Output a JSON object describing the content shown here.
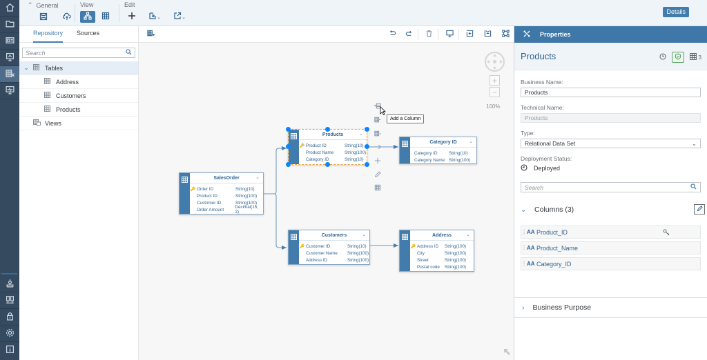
{
  "rail": {
    "items": [
      {
        "icon": "home-icon",
        "active": false
      },
      {
        "icon": "folder-icon",
        "active": false
      },
      {
        "icon": "contact-card-icon",
        "active": false
      },
      {
        "icon": "presentation-icon",
        "active": false
      },
      {
        "icon": "data-builder-icon",
        "active": true
      },
      {
        "icon": "monitor-icon",
        "active": false
      }
    ],
    "bottom_items": [
      {
        "icon": "network-icon"
      },
      {
        "icon": "connections-icon"
      },
      {
        "icon": "lock-icon"
      },
      {
        "icon": "settings-icon"
      },
      {
        "icon": "info-icon"
      }
    ]
  },
  "toolbar": {
    "general_label": "General",
    "view_label": "View",
    "edit_label": "Edit",
    "details_label": "Details"
  },
  "repository": {
    "tabs": [
      {
        "label": "Repository",
        "selected": true
      },
      {
        "label": "Sources",
        "selected": false
      }
    ],
    "search_placeholder": "Search",
    "tree": {
      "tables_label": "Tables",
      "tables": [
        "Address",
        "Customers",
        "Products"
      ],
      "views_label": "Views"
    }
  },
  "canvas": {
    "zoom_level": "100%",
    "tooltip": "Add a Column",
    "entities": {
      "salesorder": {
        "name": "SalesOrder",
        "columns": [
          {
            "name": "Order ID",
            "type": "String(10)",
            "key": true
          },
          {
            "name": "Product ID",
            "type": "String(100)",
            "key": false
          },
          {
            "name": "Customer ID",
            "type": "String(100)",
            "key": false
          },
          {
            "name": "Order Amount",
            "type": "Decimal(15, 2)",
            "key": false
          }
        ]
      },
      "products": {
        "name": "Products",
        "selected": true,
        "columns": [
          {
            "name": "Product ID",
            "type": "String(10)",
            "key": true
          },
          {
            "name": "Product Name",
            "type": "String(100)",
            "key": false
          },
          {
            "name": "Category ID",
            "type": "String(10)",
            "key": false
          }
        ]
      },
      "category": {
        "name": "Category ID",
        "columns": [
          {
            "name": "Category ID",
            "type": "String(10)",
            "key": false
          },
          {
            "name": "Category Name",
            "type": "String(100)",
            "key": false
          }
        ]
      },
      "customers": {
        "name": "Customers",
        "columns": [
          {
            "name": "Customer ID",
            "type": "String(10)",
            "key": true
          },
          {
            "name": "Customer Name",
            "type": "String(100)",
            "key": false
          },
          {
            "name": "Address ID",
            "type": "String(100)",
            "key": false
          }
        ]
      },
      "address": {
        "name": "Address",
        "columns": [
          {
            "name": "Address ID",
            "type": "String(100)",
            "key": true
          },
          {
            "name": "City",
            "type": "String(100)",
            "key": false
          },
          {
            "name": "Street",
            "type": "String(100)",
            "key": false
          },
          {
            "name": "Postal code",
            "type": "String(100)",
            "key": false
          }
        ]
      }
    }
  },
  "properties": {
    "header": "Properties",
    "title": "Products",
    "column_count": "3",
    "business_name_label": "Business Name:",
    "business_name": "Products",
    "technical_name_label": "Technical Name:",
    "technical_name": "Products",
    "type_label": "Type:",
    "type_value": "Relational Data Set",
    "deployment_label": "Deployment Status:",
    "deployment_status": "Deployed",
    "search_placeholder": "Search",
    "columns_header": "Columns (3)",
    "columns": [
      {
        "name": "Product_ID",
        "key": true
      },
      {
        "name": "Product_Name",
        "key": false
      },
      {
        "name": "Category_ID",
        "key": false
      }
    ],
    "business_purpose": "Business Purpose"
  }
}
